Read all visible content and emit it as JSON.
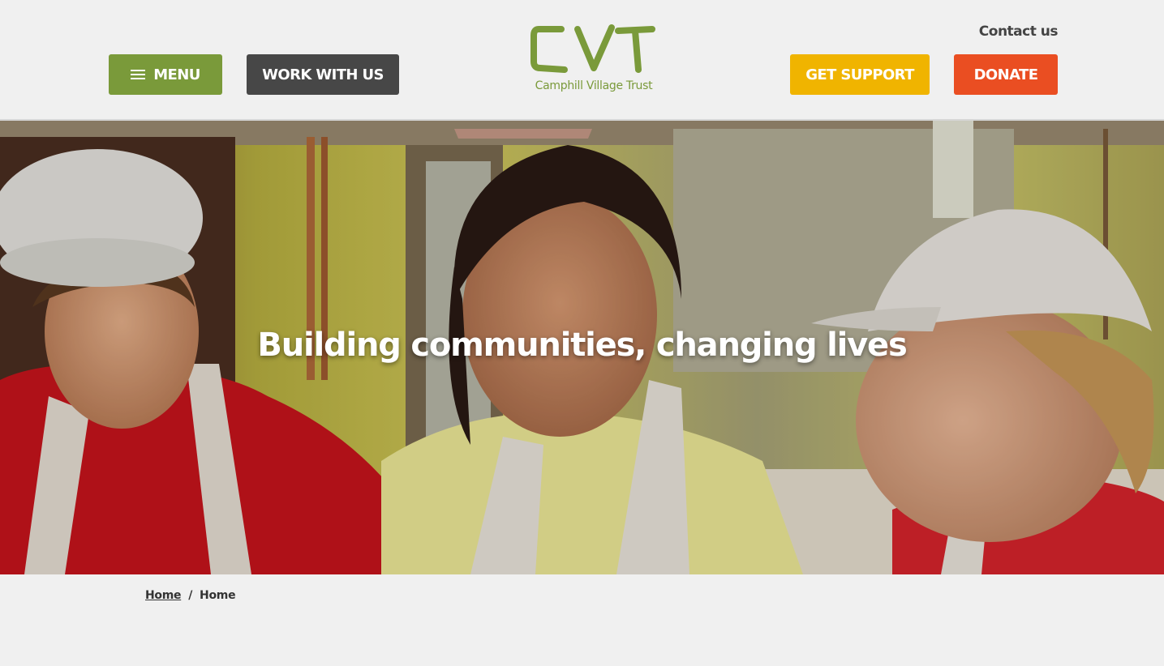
{
  "header": {
    "menu_label": "MENU",
    "work_label": "WORK WITH US",
    "support_label": "GET SUPPORT",
    "donate_label": "DONATE",
    "contact_label": "Contact us"
  },
  "logo": {
    "mark": "CVT",
    "subtitle": "Camphill Village Trust"
  },
  "hero": {
    "title": "Building communities, changing lives"
  },
  "breadcrumb": {
    "home_link": "Home",
    "separator": "/",
    "current": "Home"
  },
  "colors": {
    "brand_green": "#7a9a3a",
    "dark_gray": "#474747",
    "support_yellow": "#f0b400",
    "donate_orange": "#ea4e22",
    "background": "#f0f0f0"
  },
  "icons": {
    "menu": "hamburger-icon"
  }
}
